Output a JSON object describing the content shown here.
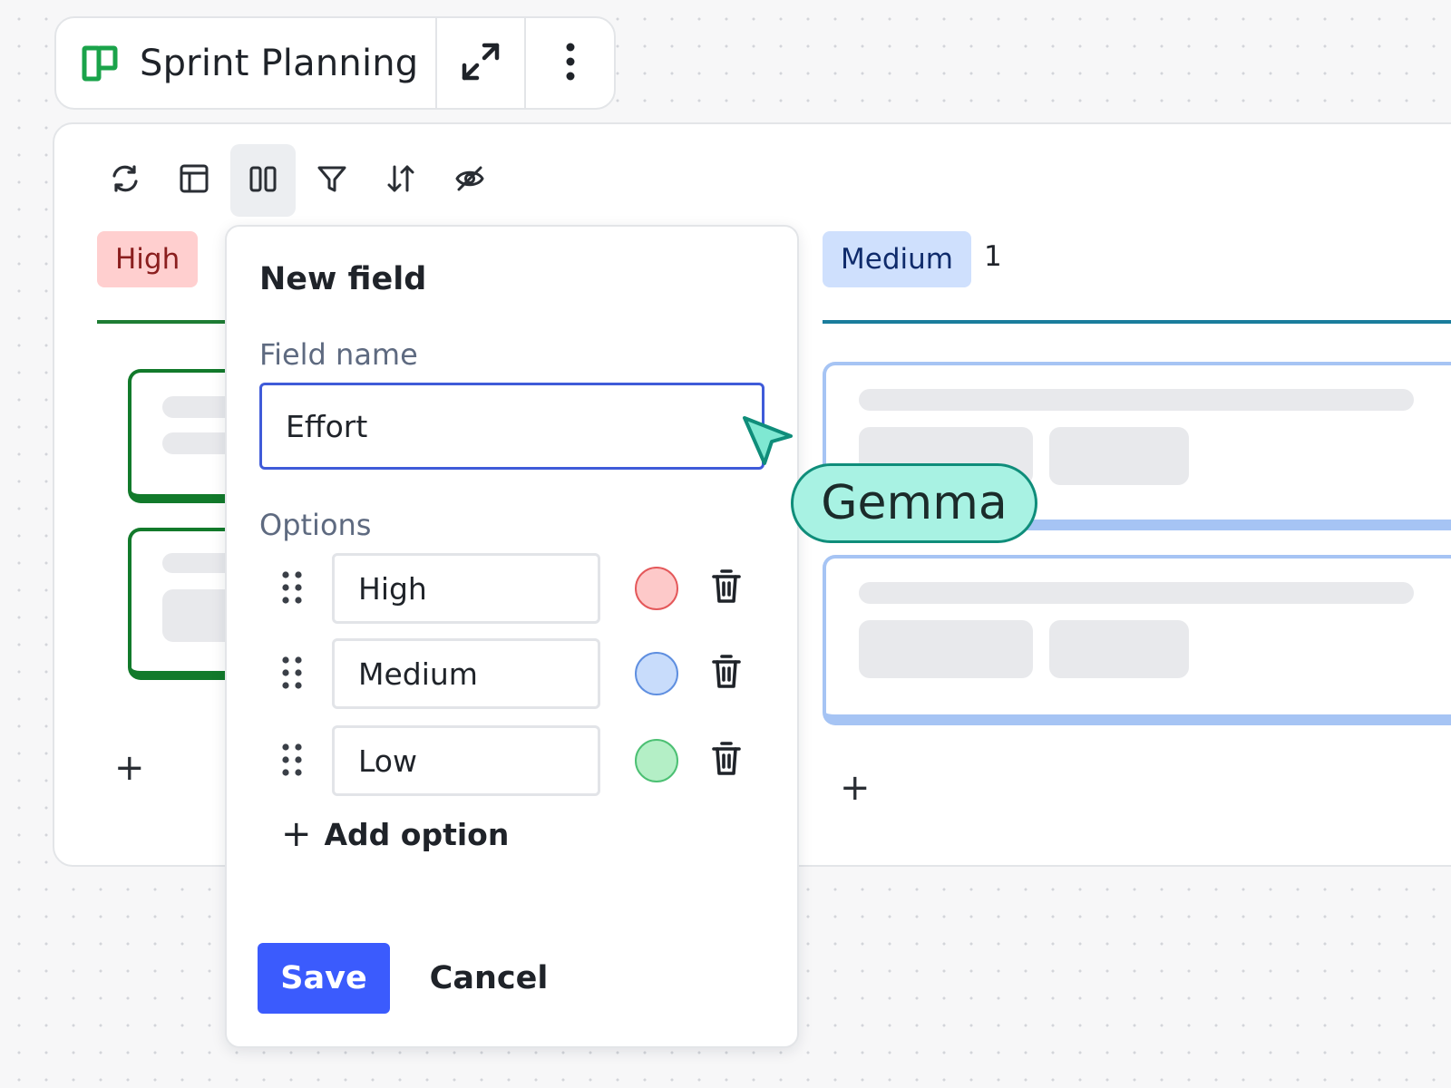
{
  "header": {
    "title": "Sprint Planning",
    "icons": {
      "board": "board-icon",
      "expand": "expand-icon",
      "more": "more-vertical-icon"
    }
  },
  "toolbar": {
    "tools": [
      "refresh-icon",
      "layout-icon",
      "columns-icon",
      "filter-icon",
      "sort-icon",
      "hide-icon"
    ],
    "active_tool": "columns-icon"
  },
  "board": {
    "columns": [
      {
        "label": "High",
        "color": "#ffcfcf",
        "text_color": "#8a1e1e",
        "accent": "#1e7d34"
      },
      {
        "label": "Medium",
        "color": "#cfe0fd",
        "text_color": "#0f2b6b",
        "accent": "#1a7d9c",
        "count": "1"
      }
    ],
    "add_card": "+"
  },
  "popover": {
    "title": "New field",
    "field_name_label": "Field name",
    "field_name_value": "Effort",
    "options_label": "Options",
    "options": [
      {
        "label": "High",
        "color": "#fdc9c9"
      },
      {
        "label": "Medium",
        "color": "#c8dcfb"
      },
      {
        "label": "Low",
        "color": "#b4efc6"
      }
    ],
    "add_option": "Add option",
    "save": "Save",
    "cancel": "Cancel",
    "save_color": "#3b5bfd"
  },
  "collaborator": {
    "name": "Gemma",
    "color": "#a8f2e3",
    "border_color": "#0f8d7a"
  }
}
